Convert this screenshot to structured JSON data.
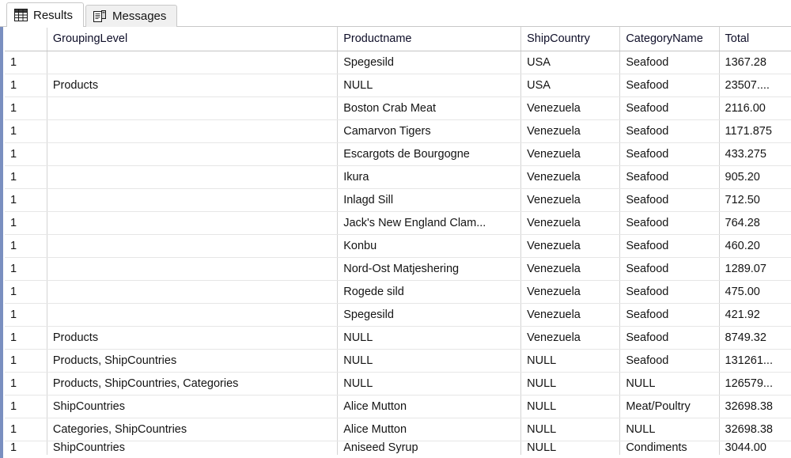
{
  "tabs": [
    {
      "label": "Results",
      "icon": "grid-icon",
      "active": true
    },
    {
      "label": "Messages",
      "icon": "document-icon",
      "active": false
    }
  ],
  "grid": {
    "columns": [
      {
        "key": "rownum",
        "label": ""
      },
      {
        "key": "grouping_level",
        "label": "GroupingLevel"
      },
      {
        "key": "productname",
        "label": "Productname"
      },
      {
        "key": "shipcountry",
        "label": "ShipCountry"
      },
      {
        "key": "categoryname",
        "label": "CategoryName"
      },
      {
        "key": "total",
        "label": "Total"
      }
    ],
    "null_text": "NULL",
    "null_highlight_color": "#fdfde3",
    "selection_bar_color": "#7a8fc0",
    "rows": [
      {
        "rownum": "1",
        "grouping_level": "",
        "productname": "Spegesild",
        "shipcountry": "USA",
        "categoryname": "Seafood",
        "total": "1367.28"
      },
      {
        "rownum": "1",
        "grouping_level": "Products",
        "productname": "NULL",
        "shipcountry": "USA",
        "categoryname": "Seafood",
        "total": "23507...."
      },
      {
        "rownum": "1",
        "grouping_level": "",
        "productname": "Boston Crab Meat",
        "shipcountry": "Venezuela",
        "categoryname": "Seafood",
        "total": "2116.00"
      },
      {
        "rownum": "1",
        "grouping_level": "",
        "productname": "Camarvon Tigers",
        "shipcountry": "Venezuela",
        "categoryname": "Seafood",
        "total": "1171.875"
      },
      {
        "rownum": "1",
        "grouping_level": "",
        "productname": "Escargots de Bourgogne",
        "shipcountry": "Venezuela",
        "categoryname": "Seafood",
        "total": "433.275"
      },
      {
        "rownum": "1",
        "grouping_level": "",
        "productname": "Ikura",
        "shipcountry": "Venezuela",
        "categoryname": "Seafood",
        "total": "905.20"
      },
      {
        "rownum": "1",
        "grouping_level": "",
        "productname": "Inlagd Sill",
        "shipcountry": "Venezuela",
        "categoryname": "Seafood",
        "total": "712.50"
      },
      {
        "rownum": "1",
        "grouping_level": "",
        "productname": "Jack's New England Clam...",
        "shipcountry": "Venezuela",
        "categoryname": "Seafood",
        "total": "764.28"
      },
      {
        "rownum": "1",
        "grouping_level": "",
        "productname": "Konbu",
        "shipcountry": "Venezuela",
        "categoryname": "Seafood",
        "total": "460.20"
      },
      {
        "rownum": "1",
        "grouping_level": "",
        "productname": "Nord-Ost Matjeshering",
        "shipcountry": "Venezuela",
        "categoryname": "Seafood",
        "total": "1289.07"
      },
      {
        "rownum": "1",
        "grouping_level": "",
        "productname": "Rogede sild",
        "shipcountry": "Venezuela",
        "categoryname": "Seafood",
        "total": "475.00"
      },
      {
        "rownum": "1",
        "grouping_level": "",
        "productname": "Spegesild",
        "shipcountry": "Venezuela",
        "categoryname": "Seafood",
        "total": "421.92"
      },
      {
        "rownum": "1",
        "grouping_level": "Products",
        "productname": "NULL",
        "shipcountry": "Venezuela",
        "categoryname": "Seafood",
        "total": "8749.32"
      },
      {
        "rownum": "1",
        "grouping_level": "Products, ShipCountries",
        "productname": "NULL",
        "shipcountry": "NULL",
        "categoryname": "Seafood",
        "total": "131261..."
      },
      {
        "rownum": "1",
        "grouping_level": "Products, ShipCountries, Categories",
        "productname": "NULL",
        "shipcountry": "NULL",
        "categoryname": "NULL",
        "total": "126579..."
      },
      {
        "rownum": "1",
        "grouping_level": "ShipCountries",
        "productname": "Alice Mutton",
        "shipcountry": "NULL",
        "categoryname": "Meat/Poultry",
        "total": "32698.38"
      },
      {
        "rownum": "1",
        "grouping_level": "Categories, ShipCountries",
        "productname": "Alice Mutton",
        "shipcountry": "NULL",
        "categoryname": "NULL",
        "total": "32698.38"
      },
      {
        "rownum": "1",
        "grouping_level": "ShipCountries",
        "productname": "Aniseed Syrup",
        "shipcountry": "NULL",
        "categoryname": "Condiments",
        "total": "3044.00"
      }
    ]
  }
}
